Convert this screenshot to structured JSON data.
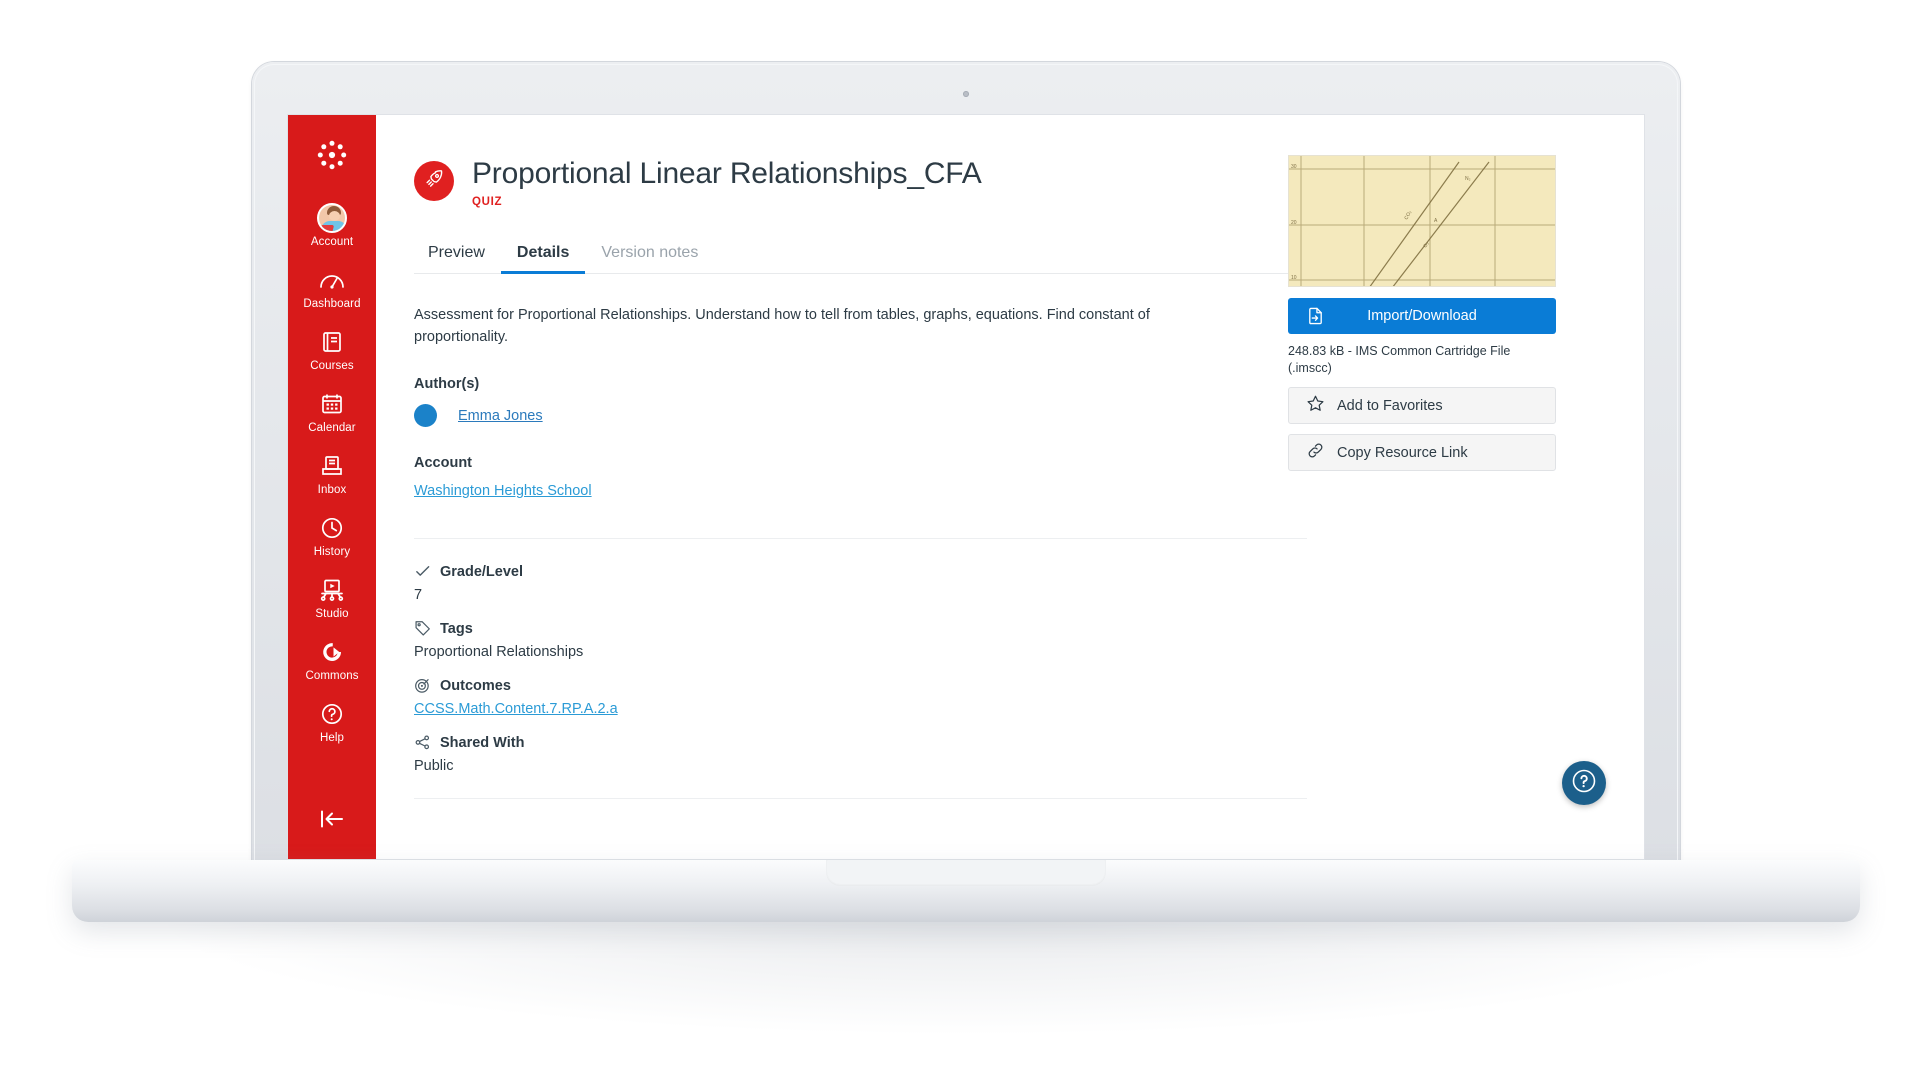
{
  "global_nav": {
    "logo": "canvas-logo",
    "items": [
      {
        "id": "account",
        "label": "Account",
        "icon": "user-avatar-icon"
      },
      {
        "id": "dashboard",
        "label": "Dashboard",
        "icon": "speedometer-icon"
      },
      {
        "id": "courses",
        "label": "Courses",
        "icon": "book-icon"
      },
      {
        "id": "calendar",
        "label": "Calendar",
        "icon": "calendar-icon"
      },
      {
        "id": "inbox",
        "label": "Inbox",
        "icon": "inbox-tray-icon"
      },
      {
        "id": "history",
        "label": "History",
        "icon": "clock-icon"
      },
      {
        "id": "studio",
        "label": "Studio",
        "icon": "studio-screen-icon"
      },
      {
        "id": "commons",
        "label": "Commons",
        "icon": "commons-arrow-icon"
      },
      {
        "id": "help",
        "label": "Help",
        "icon": "question-circle-icon"
      }
    ],
    "collapse_icon": "collapse-left-arrow-icon",
    "background_color": "#D81A1A"
  },
  "header": {
    "title": "Proportional Linear Relationships_CFA",
    "kind": "QUIZ",
    "kind_color": "#E02020",
    "type_icon": "rocket-icon",
    "type_badge_color": "#E02020"
  },
  "tabs": [
    {
      "label": "Preview",
      "state": "inactive"
    },
    {
      "label": "Details",
      "state": "active"
    },
    {
      "label": "Version notes",
      "state": "disabled"
    }
  ],
  "tab_accent_color": "#0A7CD6",
  "details": {
    "description": "Assessment for Proportional Relationships. Understand how to tell from tables, graphs, equations. Find constant of proportionality.",
    "authors_heading": "Author(s)",
    "author_name": "Emma Jones",
    "author_avatar_color": "#1B82C9",
    "account_heading": "Account",
    "account_name": "Washington Heights School",
    "link_color": "#2B9BD6",
    "meta": [
      {
        "icon": "check-icon",
        "label": "Grade/Level",
        "value": "7",
        "is_link": false
      },
      {
        "icon": "tag-icon",
        "label": "Tags",
        "value": "Proportional Relationships",
        "is_link": false
      },
      {
        "icon": "target-icon",
        "label": "Outcomes",
        "value": "CCSS.Math.Content.7.RP.A.2.a",
        "is_link": true
      },
      {
        "icon": "share-icon",
        "label": "Shared With",
        "value": "Public",
        "is_link": false
      }
    ]
  },
  "side_panel": {
    "thumbnail_alt": "resource-thumbnail-graph-paper",
    "import_button": {
      "label": "Import/Download",
      "icon": "import-document-icon",
      "color": "#0A7CD6"
    },
    "file_meta": "248.83 kB - IMS Common Cartridge File (.imscc)",
    "actions": [
      {
        "label": "Add to Favorites",
        "icon": "star-icon"
      },
      {
        "label": "Copy Resource Link",
        "icon": "link-icon"
      }
    ]
  },
  "help_fab": {
    "icon": "question-mark-icon",
    "color": "#1C5F8B"
  }
}
